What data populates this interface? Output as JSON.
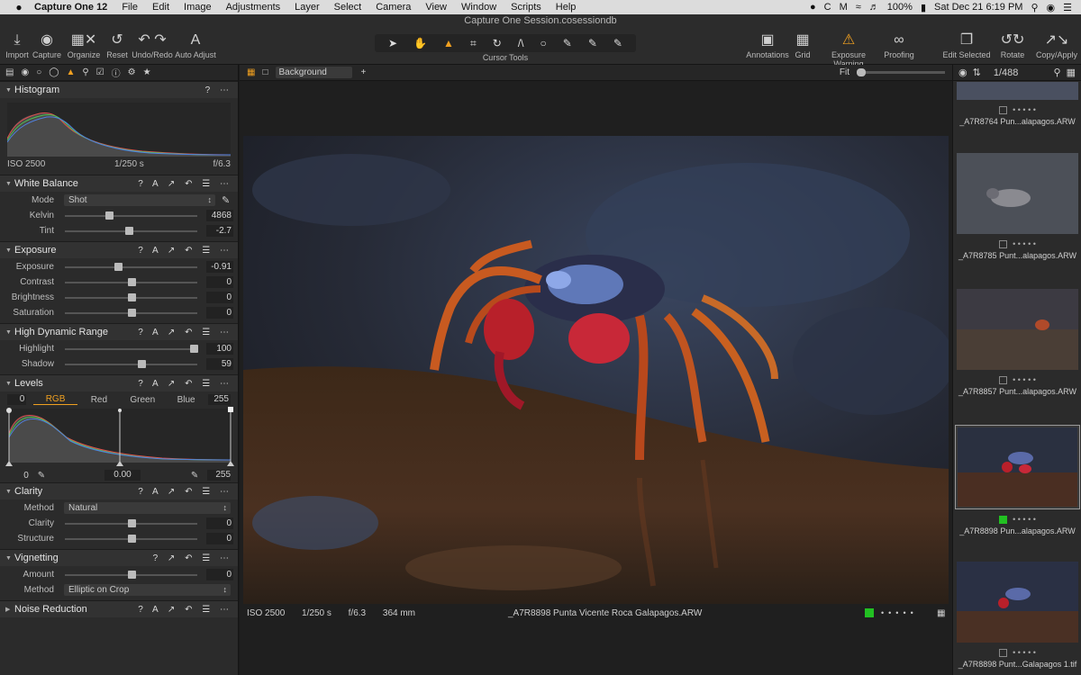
{
  "menubar": {
    "items": [
      "Capture One 12",
      "File",
      "Edit",
      "Image",
      "Adjustments",
      "Layer",
      "Select",
      "Camera",
      "View",
      "Window",
      "Scripts",
      "Help"
    ],
    "battery": "100%",
    "datetime": "Sat Dec 21  6:19 PM"
  },
  "window_title": "Capture One Session.cosessiondb",
  "toolbar": {
    "import": "Import",
    "capture": "Capture",
    "organize": "Organize",
    "reset": "Reset",
    "undo_redo": "Undo/Redo",
    "auto_adjust": "Auto Adjust",
    "cursor_tools": "Cursor Tools",
    "annotations": "Annotations",
    "grid": "Grid",
    "exposure_warning": "Exposure Warning",
    "proofing": "Proofing",
    "edit_selected": "Edit Selected",
    "rotate": "Rotate",
    "copy_apply": "Copy/Apply",
    "accent": "#f0a020"
  },
  "histogram": {
    "title": "Histogram",
    "iso": "ISO 2500",
    "shutter": "1/250 s",
    "aperture": "f/6.3"
  },
  "white_balance": {
    "title": "White Balance",
    "mode_label": "Mode",
    "mode_value": "Shot",
    "kelvin_label": "Kelvin",
    "kelvin_value": "4868",
    "kelvin_level": 0.33,
    "tint_label": "Tint",
    "tint_value": "-2.7",
    "tint_level": 0.48
  },
  "exposure": {
    "title": "Exposure",
    "rows": [
      {
        "label": "Exposure",
        "value": "-0.91",
        "level": 0.4
      },
      {
        "label": "Contrast",
        "value": "0",
        "level": 0.5
      },
      {
        "label": "Brightness",
        "value": "0",
        "level": 0.5
      },
      {
        "label": "Saturation",
        "value": "0",
        "level": 0.5
      }
    ]
  },
  "hdr": {
    "title": "High Dynamic Range",
    "rows": [
      {
        "label": "Highlight",
        "value": "100",
        "level": 0.97
      },
      {
        "label": "Shadow",
        "value": "59",
        "level": 0.58
      }
    ]
  },
  "levels": {
    "title": "Levels",
    "low": "0",
    "high": "255",
    "tabs": [
      "RGB",
      "Red",
      "Green",
      "Blue"
    ],
    "foot_low": "0",
    "foot_mid": "0.00",
    "foot_high": "255"
  },
  "clarity": {
    "title": "Clarity",
    "method_label": "Method",
    "method_value": "Natural",
    "rows": [
      {
        "label": "Clarity",
        "value": "0",
        "level": 0.5
      },
      {
        "label": "Structure",
        "value": "0",
        "level": 0.5
      }
    ]
  },
  "vignetting": {
    "title": "Vignetting",
    "amount_label": "Amount",
    "amount_value": "0",
    "amount_level": 0.5,
    "method_label": "Method",
    "method_value": "Elliptic on Crop"
  },
  "noise_reduction": {
    "title": "Noise Reduction"
  },
  "viewer": {
    "background": "Background",
    "fit": "Fit",
    "iso": "ISO 2500",
    "shutter": "1/250 s",
    "aperture": "f/6.3",
    "focal": "364 mm",
    "filename": "_A7R8898 Punta Vicente Roca  Galapagos.ARW",
    "tag_color": "#22c022"
  },
  "browser": {
    "count": "1/488",
    "thumbs": [
      {
        "name": "_A7R8764 Pun...alapagos.ARW"
      },
      {
        "name": "_A7R8785 Punt...alapagos.ARW"
      },
      {
        "name": "_A7R8857 Punt...alapagos.ARW"
      },
      {
        "name": "_A7R8898 Pun...alapagos.ARW"
      },
      {
        "name": "_A7R8898 Punt...Galapagos 1.tif"
      }
    ]
  }
}
